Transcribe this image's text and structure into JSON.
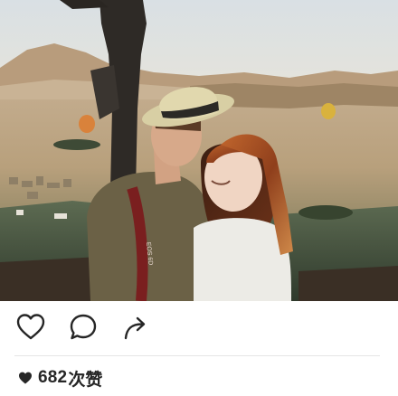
{
  "post": {
    "photo": {
      "subject": "couple-in-hot-air-balloon-basket",
      "camera_strap_text": "EOS 6D"
    },
    "actions": {
      "like_icon": "heart-outline-icon",
      "comment_icon": "speech-bubble-icon",
      "share_icon": "share-arrow-icon"
    },
    "likes": {
      "icon": "heart-filled-icon",
      "count": "682",
      "unit": "次赞"
    }
  },
  "colors": {
    "icon": "#262626",
    "divider": "#e6e6e6",
    "background": "#ffffff"
  }
}
